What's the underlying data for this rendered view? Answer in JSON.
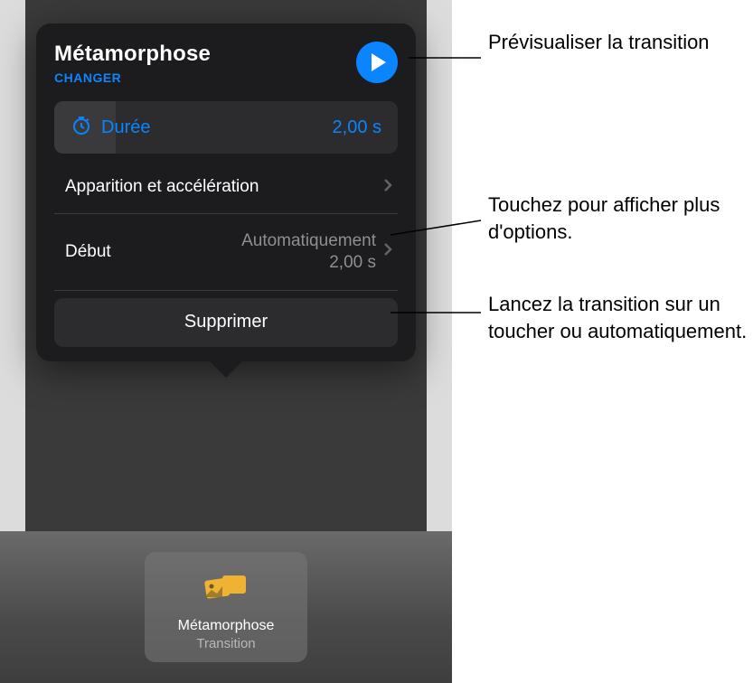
{
  "popover": {
    "title": "Métamorphose",
    "change_label": "CHANGER",
    "duration_label": "Durée",
    "duration_value": "2,00 s",
    "appearance_label": "Apparition et accélération",
    "start_label": "Début",
    "start_value_line1": "Automatiquement",
    "start_value_line2": "2,00 s",
    "delete_label": "Supprimer"
  },
  "transition_chip": {
    "title": "Métamorphose",
    "subtitle": "Transition"
  },
  "callouts": {
    "preview": "Prévisualiser la transition",
    "more_options": "Touchez pour afficher plus d'options.",
    "start_mode": "Lancez la transition sur un toucher ou automatiquement."
  },
  "icons": {
    "play": "play-icon",
    "timer": "timer-icon",
    "chevron": "chevron-right-icon",
    "slides": "slides-icon"
  },
  "colors": {
    "accent": "#0a84ff",
    "gold": "#f0b232"
  }
}
